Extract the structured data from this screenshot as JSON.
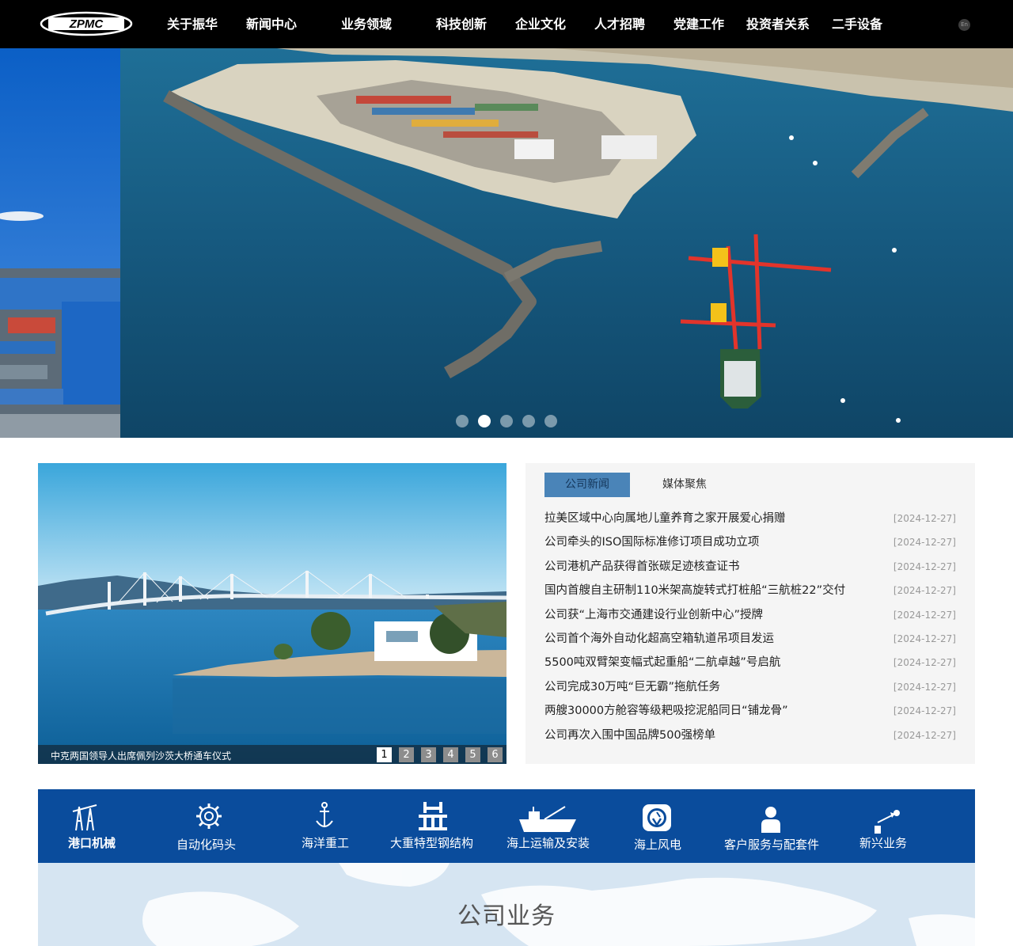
{
  "header": {
    "logo_text": "ZPMC",
    "nav": [
      {
        "label": "关于振华"
      },
      {
        "label": "新闻中心"
      },
      {
        "label": "业务领域"
      },
      {
        "label": "科技创新"
      },
      {
        "label": "企业文化"
      },
      {
        "label": "人才招聘"
      },
      {
        "label": "党建工作"
      },
      {
        "label": "投资者关系"
      },
      {
        "label": "二手设备"
      }
    ],
    "lang_label": "En"
  },
  "hero": {
    "slide_count": 5,
    "active_slide": 2
  },
  "feature": {
    "caption": "中克两国领导人出席佩列沙茨大桥通车仪式",
    "pages": [
      "1",
      "2",
      "3",
      "4",
      "5",
      "6"
    ],
    "active_page": 1
  },
  "news": {
    "tabs": [
      {
        "label": "公司新闻"
      },
      {
        "label": "媒体聚焦"
      }
    ],
    "active_tab": 1,
    "items": [
      {
        "title": "拉美区域中心向属地儿童养育之家开展爱心捐赠",
        "date": "[2024-12-27]"
      },
      {
        "title": "公司牵头的ISO国际标准修订项目成功立项",
        "date": "[2024-12-27]"
      },
      {
        "title": "公司港机产品获得首张碳足迹核查证书",
        "date": "[2024-12-27]"
      },
      {
        "title": "国内首艘自主研制110米架高旋转式打桩船“三航桩22”交付",
        "date": "[2024-12-27]"
      },
      {
        "title": "公司获“上海市交通建设行业创新中心”授牌",
        "date": "[2024-12-27]"
      },
      {
        "title": "公司首个海外自动化超高空箱轨道吊项目发运",
        "date": "[2024-12-27]"
      },
      {
        "title": "5500吨双臂架变幅式起重船“二航卓越”号启航",
        "date": "[2024-12-27]"
      },
      {
        "title": "公司完成30万吨“巨无霸”拖航任务",
        "date": "[2024-12-27]"
      },
      {
        "title": "两艘30000方舱容等级耙吸挖泥船同日“铺龙骨”",
        "date": "[2024-12-27]"
      },
      {
        "title": "公司再次入围中国品牌500强榜单",
        "date": "[2024-12-27]"
      }
    ]
  },
  "business": {
    "items": [
      {
        "label": "港口机械",
        "icon": "crane-icon"
      },
      {
        "label": "自动化码头",
        "icon": "gear-icon"
      },
      {
        "label": "海洋重工",
        "icon": "anchor-icon"
      },
      {
        "label": "大重特型钢结构",
        "icon": "steel-structure-icon"
      },
      {
        "label": "海上运输及安装",
        "icon": "ship-icon"
      },
      {
        "label": "海上风电",
        "icon": "wind-power-icon"
      },
      {
        "label": "客户服务与配套件",
        "icon": "customer-service-icon"
      },
      {
        "label": "新兴业务",
        "icon": "emerging-business-icon"
      }
    ]
  },
  "section": {
    "title": "公司业务"
  },
  "colors": {
    "header_bg": "#000000",
    "tab_active": "#4a84b8",
    "biz_strip": "#0a4c9c",
    "map_bg": "#d6e5f2"
  }
}
